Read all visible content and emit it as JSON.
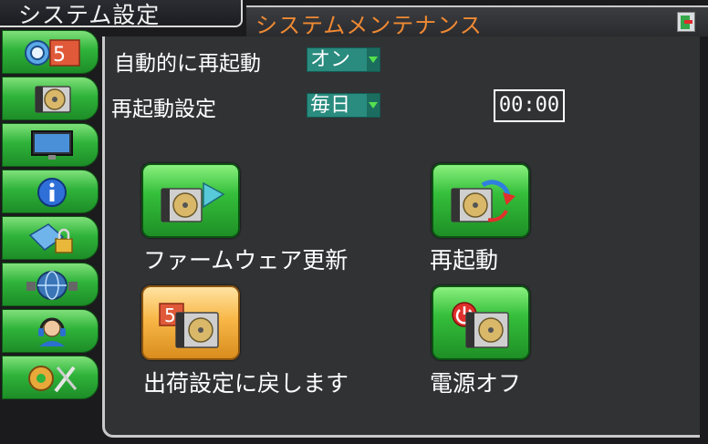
{
  "title_tab": "システム設定",
  "header": {
    "title": "システムメンテナンス",
    "exit_icon": "exit-door-icon"
  },
  "sidebar": {
    "items": [
      {
        "icon": "record-schedule-icon",
        "badge": "5"
      },
      {
        "icon": "hdd-icon"
      },
      {
        "icon": "monitor-icon"
      },
      {
        "icon": "info-icon"
      },
      {
        "icon": "security-lock-icon"
      },
      {
        "icon": "network-icon"
      },
      {
        "icon": "support-headset-icon"
      },
      {
        "icon": "tools-icon"
      }
    ]
  },
  "settings": {
    "auto_reboot_label": "自動的に再起動",
    "auto_reboot_value": "オン",
    "reboot_setting_label": "再起動設定",
    "reboot_frequency_value": "毎日",
    "reboot_time_value": "00:00"
  },
  "actions": {
    "firmware_update": "ファームウェア更新",
    "reboot": "再起動",
    "factory_reset": "出荷設定に戻します",
    "factory_reset_badge": "5",
    "power_off": "電源オフ"
  },
  "colors": {
    "accent_title": "#f08a33",
    "button_green": "#35bf3b",
    "button_orange": "#f8b747",
    "dropdown_teal": "#2a8b7f"
  }
}
